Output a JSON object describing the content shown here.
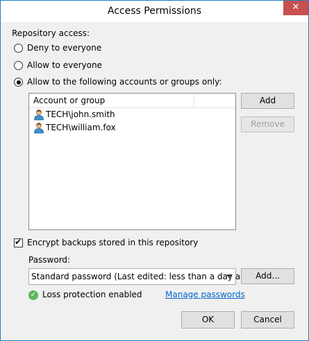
{
  "window": {
    "title": "Access Permissions",
    "close_glyph": "✕"
  },
  "repository_access": {
    "label": "Repository access:",
    "options": [
      {
        "label": "Deny to everyone",
        "selected": false
      },
      {
        "label": "Allow to everyone",
        "selected": false
      },
      {
        "label": "Allow to the following accounts or groups only:",
        "selected": true
      }
    ]
  },
  "accounts": {
    "column_header": "Account or group",
    "rows": [
      {
        "name": "TECH\\john.smith",
        "icon": "user-icon"
      },
      {
        "name": "TECH\\william.fox",
        "icon": "user-icon"
      }
    ],
    "add_label": "Add",
    "remove_label": "Remove"
  },
  "encryption": {
    "checkbox_label": "Encrypt backups stored in this repository",
    "checked": true,
    "password_label": "Password:",
    "password_value": "Standard password (Last edited: less than a day ago)",
    "add_label": "Add...",
    "status_text": "Loss protection enabled",
    "manage_link": "Manage passwords"
  },
  "footer": {
    "ok_label": "OK",
    "cancel_label": "Cancel"
  },
  "colors": {
    "accent": "#1c7fc1",
    "close_button": "#c75050",
    "status_ok": "#5cb85c",
    "link": "#0066cc"
  }
}
